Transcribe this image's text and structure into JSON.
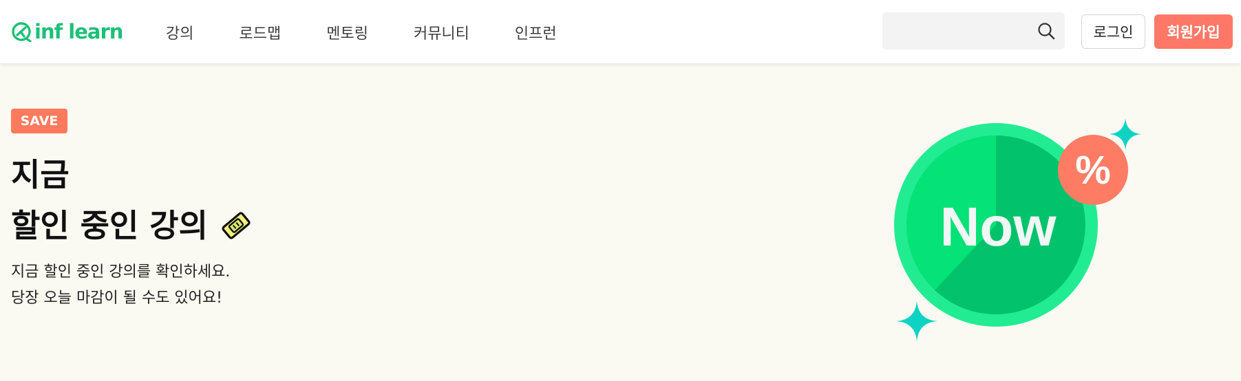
{
  "header": {
    "logo_text": "inf learn",
    "nav": [
      {
        "label": "강의"
      },
      {
        "label": "로드맵"
      },
      {
        "label": "멘토링"
      },
      {
        "label": "커뮤니티"
      },
      {
        "label": "인프런"
      }
    ],
    "search": {
      "value": "",
      "placeholder": ""
    },
    "login_label": "로그인",
    "signup_label": "회원가입"
  },
  "hero": {
    "badge": "SAVE",
    "title_line1": "지금",
    "title_line2": "할인 중인 강의",
    "description_line1": "지금 할인 중인 강의를 확인하세요.",
    "description_line2": "당장 오늘 마감이 될 수도 있어요!",
    "graphic_text": "Now",
    "graphic_badge": "%"
  },
  "colors": {
    "brand": "#1dc078",
    "accent": "#ff7867",
    "background": "#fafaf3"
  },
  "icons": {
    "logo": "inflearn-logo-icon",
    "search": "search-icon",
    "ticket": "ticket-icon",
    "sparkle": "sparkle-icon"
  }
}
